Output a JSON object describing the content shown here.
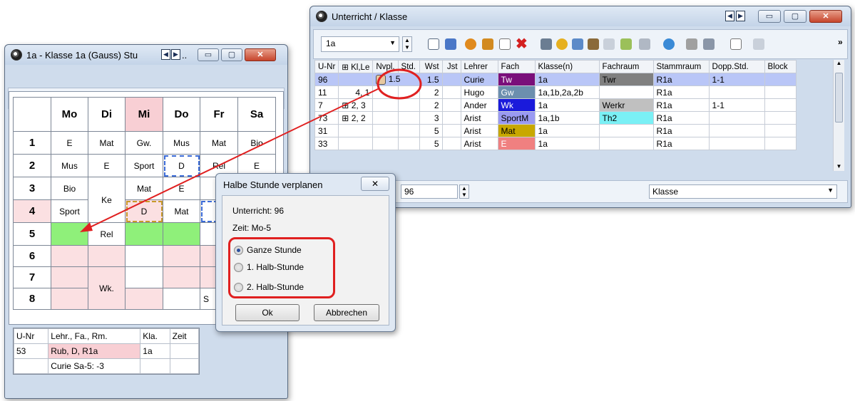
{
  "left_window": {
    "title": "1a - Klasse 1a (Gauss)  Stu",
    "title_suffix": "..",
    "grid": {
      "days": [
        "Mo",
        "Di",
        "Mi",
        "Do",
        "Fr",
        "Sa"
      ],
      "hours": [
        "1",
        "2",
        "3",
        "4",
        "5",
        "6",
        "7",
        "8"
      ],
      "cells": {
        "r1": [
          "E",
          "Mat",
          "Gw.",
          "Mus",
          "Mat",
          "Bio"
        ],
        "r2": [
          "Mus",
          "E",
          "Sport",
          "D",
          "Rel",
          "E"
        ],
        "r3": [
          "Bio",
          "",
          "Mat",
          "E"
        ],
        "r3_di": "Ke",
        "r4": [
          "Sport",
          "D",
          "Mat"
        ],
        "r5_di": "Rel",
        "r78_di": "Wk.",
        "r8_fr": "S"
      }
    },
    "lower_table": {
      "headers": [
        "U-Nr",
        "Lehr., Fa., Rm.",
        "Kla.",
        "Zeit"
      ],
      "rows": [
        {
          "unr": "53",
          "info": "Rub, D, R1a",
          "kla": "1a",
          "zeit": ""
        },
        {
          "unr": "",
          "info": "Curie Sa-5: -3",
          "kla": "",
          "zeit": ""
        }
      ]
    }
  },
  "right_window": {
    "title": "Unterricht / Klasse",
    "class_select": "1a",
    "table": {
      "headers": [
        "U-Nr",
        "Kl,Le",
        "Nvpl.",
        "Std.",
        "Wst",
        "Jst",
        "Lehrer",
        "Fach",
        "Klasse(n)",
        "Fachraum",
        "Stammraum",
        "Dopp.Std.",
        "Block"
      ],
      "rows": [
        {
          "unr": "96",
          "klle": "",
          "nvpl": "1.5",
          "std": "1.5",
          "wst": "",
          "jst": "",
          "lehrer": "Curie",
          "fach": "Tw",
          "fach_color": "#7a0f7a",
          "fach_text": "#ffffff",
          "klassen": "1a",
          "fachraum": "Twr",
          "fachraum_color": "#808080",
          "stammraum": "R1a",
          "dopp": "1-1",
          "block": "",
          "selected": true
        },
        {
          "unr": "11",
          "klle": "4, 1",
          "nvpl": "",
          "std": "",
          "wst": "2",
          "jst": "",
          "lehrer": "Hugo",
          "fach": "Gw",
          "fach_color": "#6c8fae",
          "fach_text": "#ffffff",
          "klassen": "1a,1b,2a,2b",
          "fachraum": "",
          "fachraum_color": "",
          "stammraum": "R1a",
          "dopp": "",
          "block": ""
        },
        {
          "unr": "7",
          "klle": "2, 3",
          "nvpl": "",
          "std": "",
          "wst": "2",
          "jst": "",
          "lehrer": "Ander",
          "fach": "Wk",
          "fach_color": "#1a1adb",
          "fach_text": "#ffffff",
          "klassen": "1a",
          "fachraum": "Werkr",
          "fachraum_color": "#c0c0c0",
          "stammraum": "R1a",
          "dopp": "1-1",
          "block": ""
        },
        {
          "unr": "73",
          "klle": "2, 2",
          "nvpl": "",
          "std": "",
          "wst": "3",
          "jst": "",
          "lehrer": "Arist",
          "fach": "SportM",
          "fach_color": "#9a9af2",
          "fach_text": "#000000",
          "klassen": "1a,1b",
          "fachraum": "Th2",
          "fachraum_color": "#7af0f5",
          "stammraum": "R1a",
          "dopp": "",
          "block": ""
        },
        {
          "unr": "31",
          "klle": "",
          "nvpl": "",
          "std": "",
          "wst": "5",
          "jst": "",
          "lehrer": "Arist",
          "fach": "Mat",
          "fach_color": "#c8a800",
          "fach_text": "#000000",
          "klassen": "1a",
          "fachraum": "",
          "fachraum_color": "",
          "stammraum": "R1a",
          "dopp": "",
          "block": ""
        },
        {
          "unr": "33",
          "klle": "",
          "nvpl": "",
          "std": "",
          "wst": "5",
          "jst": "",
          "lehrer": "Arist",
          "fach": "E",
          "fach_color": "#f08080",
          "fach_text": "#ffffff",
          "klassen": "1a",
          "fachraum": "",
          "fachraum_color": "",
          "stammraum": "R1a",
          "dopp": "",
          "block": ""
        }
      ]
    },
    "bottom": {
      "unr_field": "96",
      "view_select": "Klasse"
    }
  },
  "dialog": {
    "title": "Halbe Stunde verplanen",
    "unterricht": "Unterricht: 96",
    "zeit": "Zeit: Mo-5",
    "options": [
      "Ganze Stunde",
      "1. Halb-Stunde",
      "2. Halb-Stunde"
    ],
    "selected_option": 0,
    "ok": "Ok",
    "cancel": "Abbrechen"
  },
  "colors": {
    "arrow": "#e02020",
    "highlight_ring": "#e02020",
    "selected_row": "#b9c6f7"
  }
}
